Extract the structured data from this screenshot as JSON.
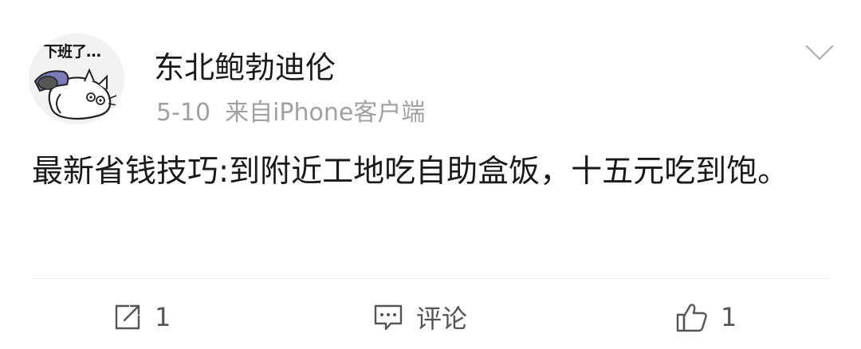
{
  "post": {
    "username": "东北鲍勃迪伦",
    "date": "5-10",
    "source": "来自iPhone客户端",
    "content": "最新省钱技巧:到附近工地吃自助盒饭，十五元吃到饱。",
    "avatar_caption": "下班了…",
    "menu_icon": "chevron-down-icon"
  },
  "actions": {
    "repost": {
      "icon": "repost-icon",
      "label": "1"
    },
    "comment": {
      "icon": "comment-icon",
      "label": "评论"
    },
    "like": {
      "icon": "thumbs-up-icon",
      "label": "1"
    }
  },
  "colors": {
    "text": "#1a1a1a",
    "meta": "#a0a0a0",
    "action": "#555555",
    "divider": "#ebebeb"
  }
}
